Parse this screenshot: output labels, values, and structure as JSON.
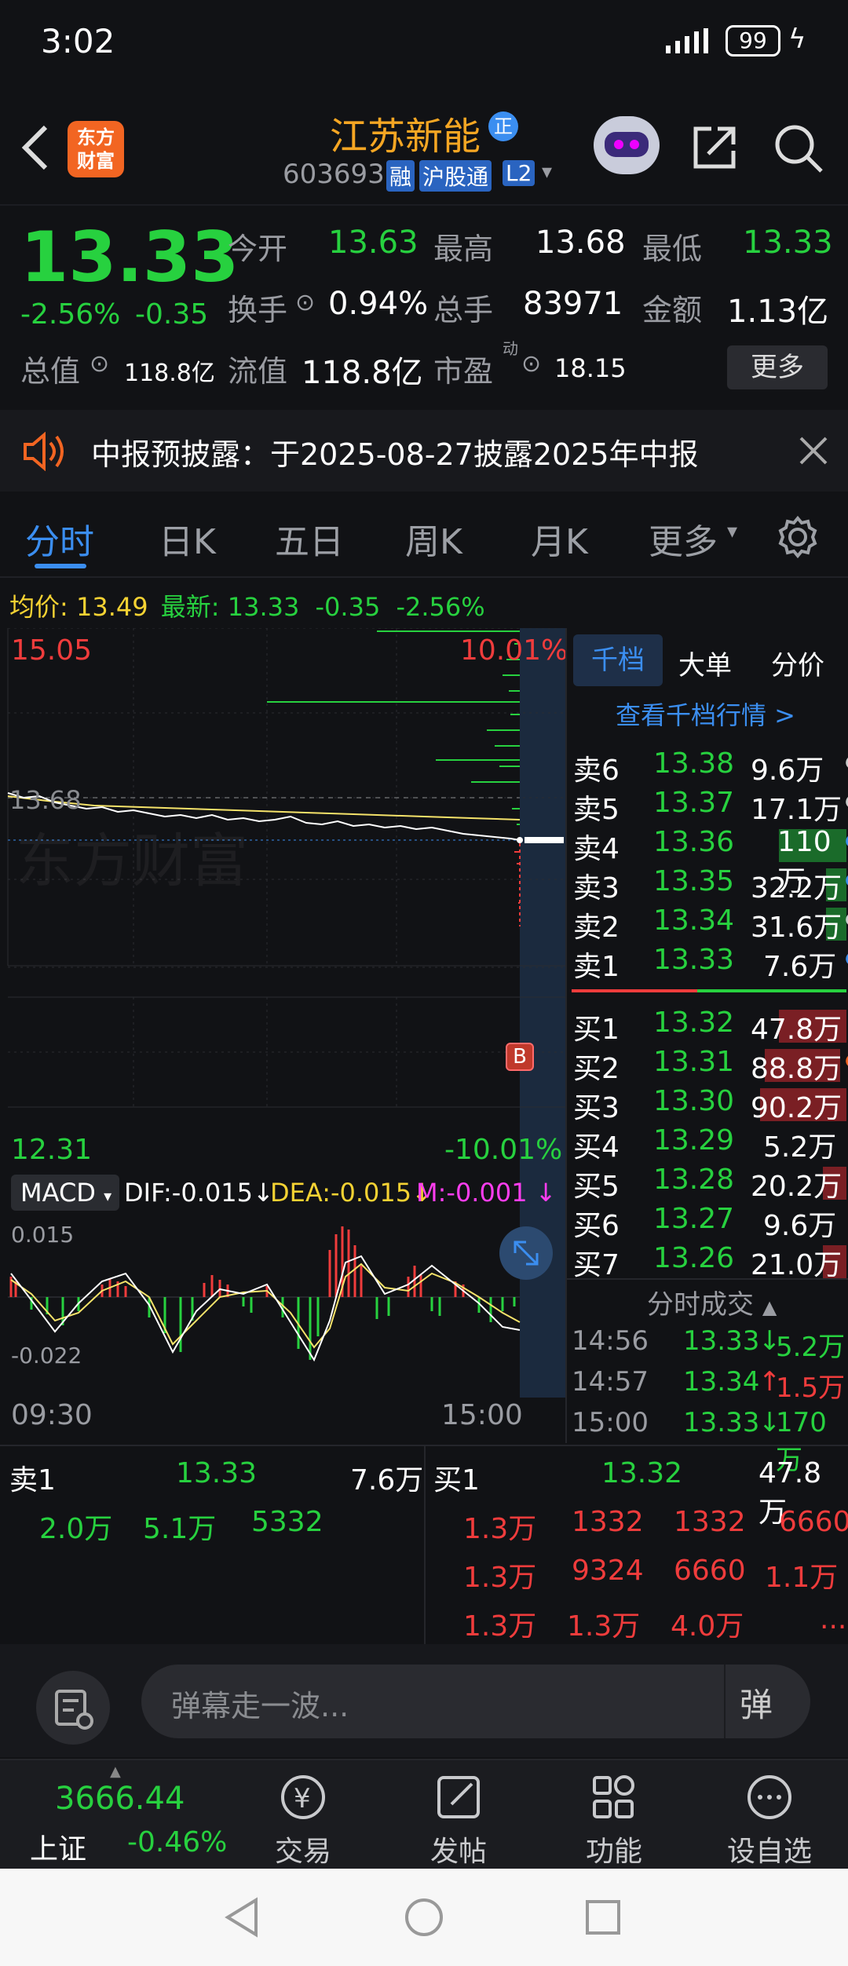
{
  "status": {
    "time": "3:02",
    "battery": "99"
  },
  "header": {
    "app_logo": "东方\n财富",
    "stock_name": "江苏新能",
    "badge": "正",
    "code": "603693",
    "tags": [
      "融",
      "沪股通",
      "L2"
    ]
  },
  "quote": {
    "price": "13.33",
    "pct": "-2.56%",
    "chg": "-0.35",
    "open_label": "今开",
    "open": "13.63",
    "high_label": "最高",
    "high": "13.68",
    "low_label": "最低",
    "low": "13.33",
    "turnover_label": "换手",
    "turnover": "0.94%",
    "volume_label": "总手",
    "volume": "83971",
    "amount_label": "金额",
    "amount": "1.13亿",
    "mktcap_label": "总值",
    "mktcap": "118.8亿",
    "float_label": "流值",
    "float": "118.8亿",
    "pe_label": "市盈",
    "pe_sup": "动",
    "pe": "18.15",
    "more_label": "更多"
  },
  "notice": {
    "text": "中报预披露：于2025-08-27披露2025年中报"
  },
  "tabs": [
    "分时",
    "日K",
    "五日",
    "周K",
    "月K",
    "更多"
  ],
  "line_info": {
    "avg_label": "均价:",
    "avg": "13.49",
    "latest_label": "最新:",
    "latest": "13.33",
    "chg": "-0.35",
    "pct": "-2.56%"
  },
  "chart": {
    "y_top": "15.05",
    "y_top_pct": "10.01%",
    "ref_price": "13.68",
    "y_bot": "12.31",
    "y_bot_pct": "-10.01%",
    "watermark": "东方财富",
    "b_marker": "B",
    "time_start": "09:30",
    "time_end": "15:00"
  },
  "macd": {
    "name": "MACD",
    "dif": "DIF:-0.015",
    "dea": "DEA:-0.015",
    "m": "M:-0.001",
    "top": "0.015",
    "bottom": "-0.022"
  },
  "book_tabs": [
    "千档",
    "大单",
    "分价"
  ],
  "book_link": "查看千档行情 >",
  "asks": [
    {
      "label": "卖6",
      "price": "13.38",
      "vol": "9.6万"
    },
    {
      "label": "卖5",
      "price": "13.37",
      "vol": "17.1万"
    },
    {
      "label": "卖4",
      "price": "13.36",
      "vol": "110万"
    },
    {
      "label": "卖3",
      "price": "13.35",
      "vol": "32.2万"
    },
    {
      "label": "卖2",
      "price": "13.34",
      "vol": "31.6万"
    },
    {
      "label": "卖1",
      "price": "13.33",
      "vol": "7.6万"
    }
  ],
  "bids": [
    {
      "label": "买1",
      "price": "13.32",
      "vol": "47.8万"
    },
    {
      "label": "买2",
      "price": "13.31",
      "vol": "88.8万"
    },
    {
      "label": "买3",
      "price": "13.30",
      "vol": "90.2万"
    },
    {
      "label": "买4",
      "price": "13.29",
      "vol": "5.2万"
    },
    {
      "label": "买5",
      "price": "13.28",
      "vol": "20.2万"
    },
    {
      "label": "买6",
      "price": "13.27",
      "vol": "9.6万"
    },
    {
      "label": "买7",
      "price": "13.26",
      "vol": "21.0万"
    }
  ],
  "trades_title": "分时成交",
  "trades": [
    {
      "time": "14:56",
      "price": "13.33",
      "arrow": "↓",
      "vol": "5.2万"
    },
    {
      "time": "14:57",
      "price": "13.34",
      "arrow": "↑",
      "vol": "1.5万"
    },
    {
      "time": "15:00",
      "price": "13.33",
      "arrow": "↓",
      "vol": "170万"
    }
  ],
  "queue": {
    "sell_label": "卖1",
    "sell_price": "13.33",
    "sell_vol": "7.6万",
    "buy_label": "买1",
    "buy_price": "13.32",
    "buy_vol": "47.8万",
    "sell_orders": [
      "2.0万",
      "5.1万",
      "5332"
    ],
    "buy_orders": [
      [
        "1.3万",
        "1332",
        "1332",
        "6660"
      ],
      [
        "1.3万",
        "9324",
        "6660",
        "1.1万"
      ],
      [
        "1.3万",
        "1.3万",
        "4.0万",
        "..."
      ]
    ]
  },
  "barrage": {
    "placeholder": "弹幕走一波...",
    "btn": "弹"
  },
  "bottom": {
    "index_value": "3666.44",
    "index_name": "上证",
    "index_pct": "-0.46%",
    "trade": "交易",
    "post": "发帖",
    "func": "功能",
    "fav": "设自选"
  },
  "colors": {
    "up": "#f03c3c",
    "down": "#27d13f",
    "avg_line": "#f5e36a",
    "accent": "#3b8ef0",
    "name": "#f5a623"
  }
}
